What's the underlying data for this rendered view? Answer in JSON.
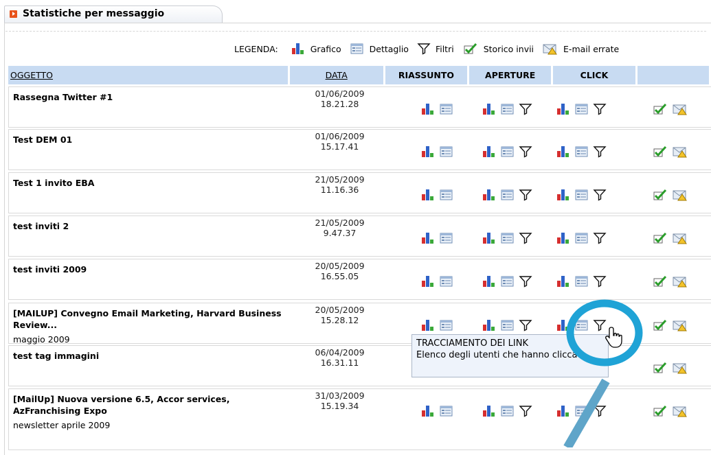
{
  "tab": {
    "title": "Statistiche per messaggio",
    "icon": "play-arrow-icon"
  },
  "legend": {
    "label": "LEGENDA:",
    "items": [
      {
        "name": "grafico",
        "label": "Grafico",
        "icon": "bar-chart-icon"
      },
      {
        "name": "dettaglio",
        "label": "Dettaglio",
        "icon": "detail-list-icon"
      },
      {
        "name": "filtri",
        "label": "Filtri",
        "icon": "filter-funnel-icon"
      },
      {
        "name": "storico",
        "label": "Storico invii",
        "icon": "green-check-icon"
      },
      {
        "name": "errate",
        "label": "E-mail errate",
        "icon": "email-warning-icon"
      }
    ]
  },
  "table": {
    "headers": {
      "oggetto": "OGGETTO",
      "data": "DATA",
      "riassunto": "RIASSUNTO",
      "aperture": "APERTURE",
      "click": "CLICK"
    },
    "rows": [
      {
        "subject": "Rassegna Twitter #1",
        "sub": "",
        "date": "01/06/2009",
        "time": "18.21.28"
      },
      {
        "subject": "Test DEM 01",
        "sub": "",
        "date": "01/06/2009",
        "time": "15.17.41"
      },
      {
        "subject": "Test 1 invito EBA",
        "sub": "",
        "date": "21/05/2009",
        "time": "11.16.36"
      },
      {
        "subject": "test inviti 2",
        "sub": "",
        "date": "21/05/2009",
        "time": "9.47.37"
      },
      {
        "subject": "test inviti 2009",
        "sub": "",
        "date": "20/05/2009",
        "time": "16.55.05"
      },
      {
        "subject": "[MAILUP] Convegno Email Marketing, Harvard Business Review...",
        "sub": "maggio 2009",
        "date": "20/05/2009",
        "time": "15.28.12"
      },
      {
        "subject": "test tag immagini",
        "sub": "",
        "date": "06/04/2009",
        "time": "16.31.11"
      },
      {
        "subject": "[MailUp] Nuova versione 6.5, Accor services, AzFranchising Expo",
        "sub": "newsletter aprile 2009",
        "date": "31/03/2009",
        "time": "15.19.34"
      }
    ]
  },
  "tooltip": {
    "title": "TRACCIAMENTO DEI LINK",
    "text": "Elenco degli utenti che hanno cliccato"
  },
  "colors": {
    "header_bg": "#c8dbf2",
    "highlight_ring": "#1fa3d6",
    "tooltip_bg": "#eef3fb",
    "tab_icon": "#e8531c"
  }
}
